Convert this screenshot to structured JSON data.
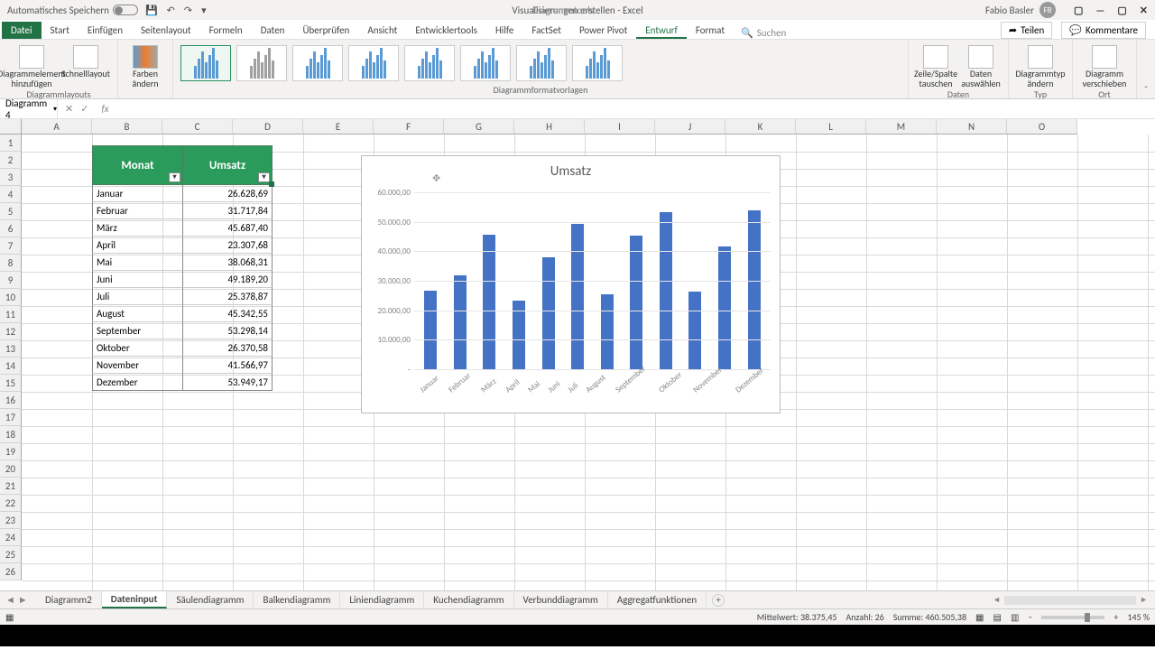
{
  "titlebar": {
    "autosave": "Automatisches Speichern",
    "doc": "Visualisierungen erstellen   -   Excel",
    "tools": "Diagrammtools",
    "user": "Fabio Basler",
    "user_initials": "FB"
  },
  "ribbon_tabs": {
    "file": "Datei",
    "items": [
      "Start",
      "Einfügen",
      "Seitenlayout",
      "Formeln",
      "Daten",
      "Überprüfen",
      "Ansicht",
      "Entwicklertools",
      "Hilfe",
      "FactSet",
      "Power Pivot",
      "Entwurf",
      "Format"
    ],
    "active_index": 11,
    "search": "Suchen",
    "share": "Teilen",
    "comments": "Kommentare"
  },
  "ribbon_groups": {
    "g1": {
      "btn1": "Diagrammelement hinzufügen",
      "btn2": "Schnelllayout",
      "label": "Diagrammlayouts"
    },
    "g2": {
      "btn1": "Farben ändern"
    },
    "g3": {
      "label": "Diagrammformatvorlagen"
    },
    "g4": {
      "btn1": "Zeile/Spalte tauschen",
      "btn2": "Daten auswählen",
      "label": "Daten"
    },
    "g5": {
      "btn1": "Diagrammtyp ändern",
      "label": "Typ"
    },
    "g6": {
      "btn1": "Diagramm verschieben",
      "label": "Ort"
    }
  },
  "namebox": "Diagramm 4",
  "columns": [
    "A",
    "B",
    "C",
    "D",
    "E",
    "F",
    "G",
    "H",
    "I",
    "J",
    "K",
    "L",
    "M",
    "N",
    "O"
  ],
  "table": {
    "head_month": "Monat",
    "head_value": "Umsatz",
    "rows": [
      {
        "m": "Januar",
        "v": "26.628,69"
      },
      {
        "m": "Februar",
        "v": "31.717,84"
      },
      {
        "m": "März",
        "v": "45.687,40"
      },
      {
        "m": "April",
        "v": "23.307,68"
      },
      {
        "m": "Mai",
        "v": "38.068,31"
      },
      {
        "m": "Juni",
        "v": "49.189,20"
      },
      {
        "m": "Juli",
        "v": "25.378,87"
      },
      {
        "m": "August",
        "v": "45.342,55"
      },
      {
        "m": "September",
        "v": "53.298,14"
      },
      {
        "m": "Oktober",
        "v": "26.370,58"
      },
      {
        "m": "November",
        "v": "41.566,97"
      },
      {
        "m": "Dezember",
        "v": "53.949,17"
      }
    ]
  },
  "chart_data": {
    "type": "bar",
    "title": "Umsatz",
    "categories": [
      "Januar",
      "Februar",
      "März",
      "April",
      "Mai",
      "Juni",
      "Juli",
      "August",
      "September",
      "Oktober",
      "November",
      "Dezember"
    ],
    "values": [
      26628.69,
      31717.84,
      45687.4,
      23307.68,
      38068.31,
      49189.2,
      25378.87,
      45342.55,
      53298.14,
      26370.58,
      41566.97,
      53949.17
    ],
    "ylim": [
      0,
      60000
    ],
    "ytick_labels": [
      "-",
      "10.000,00",
      "20.000,00",
      "30.000,00",
      "40.000,00",
      "50.000,00",
      "60.000,00"
    ]
  },
  "sheet_tabs": {
    "items": [
      "Diagramm2",
      "Dateninput",
      "Säulendiagramm",
      "Balkendiagramm",
      "Liniendiagramm",
      "Kuchendiagramm",
      "Verbunddiagramm",
      "Aggregatfunktionen"
    ],
    "active_index": 1
  },
  "status": {
    "avg_label": "Mittelwert:",
    "avg": "38.375,45",
    "count_label": "Anzahl:",
    "count": "26",
    "sum_label": "Summe:",
    "sum": "460.505,38",
    "zoom": "145 %"
  }
}
